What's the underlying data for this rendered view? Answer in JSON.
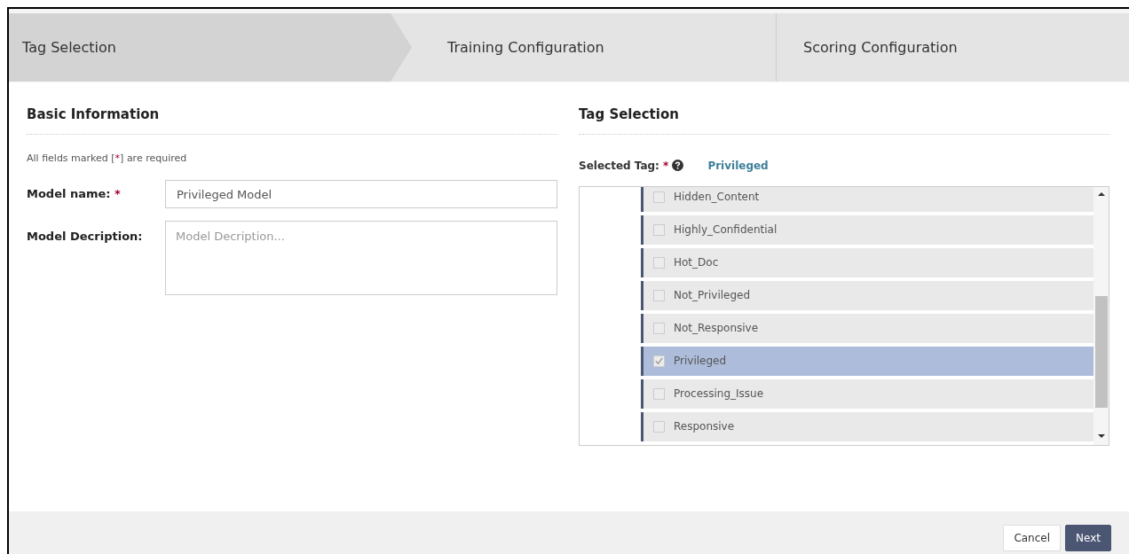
{
  "steps": [
    {
      "label": "Tag Selection",
      "selected": true
    },
    {
      "label": "Training Configuration",
      "selected": false
    },
    {
      "label": "Scoring Configuration",
      "selected": false
    }
  ],
  "basic_information": {
    "title": "Basic Information",
    "required_note": {
      "before": "All fields marked [",
      "mark": "*",
      "after": "] are required"
    },
    "model_name": {
      "label": "Model name:",
      "required_mark": "*",
      "value": "Privileged Model"
    },
    "model_description": {
      "label": "Model Decription:",
      "placeholder": "Model Decription..."
    }
  },
  "tag_selection": {
    "title": "Tag Selection",
    "selected_tag_label": "Selected Tag:",
    "required_mark": "*",
    "selected_tag": "Privileged",
    "tags": [
      {
        "label": "Hidden_Content",
        "checked": false,
        "selected": false
      },
      {
        "label": "Highly_Confidential",
        "checked": false,
        "selected": false
      },
      {
        "label": "Hot_Doc",
        "checked": false,
        "selected": false
      },
      {
        "label": "Not_Privileged",
        "checked": false,
        "selected": false
      },
      {
        "label": "Not_Responsive",
        "checked": false,
        "selected": false
      },
      {
        "label": "Privileged",
        "checked": true,
        "selected": true
      },
      {
        "label": "Processing_Issue",
        "checked": false,
        "selected": false
      },
      {
        "label": "Responsive",
        "checked": false,
        "selected": false
      }
    ]
  },
  "buttons": [
    {
      "label": "Cancel",
      "kind": "secondary"
    },
    {
      "label": "Next",
      "kind": "primary"
    }
  ]
}
